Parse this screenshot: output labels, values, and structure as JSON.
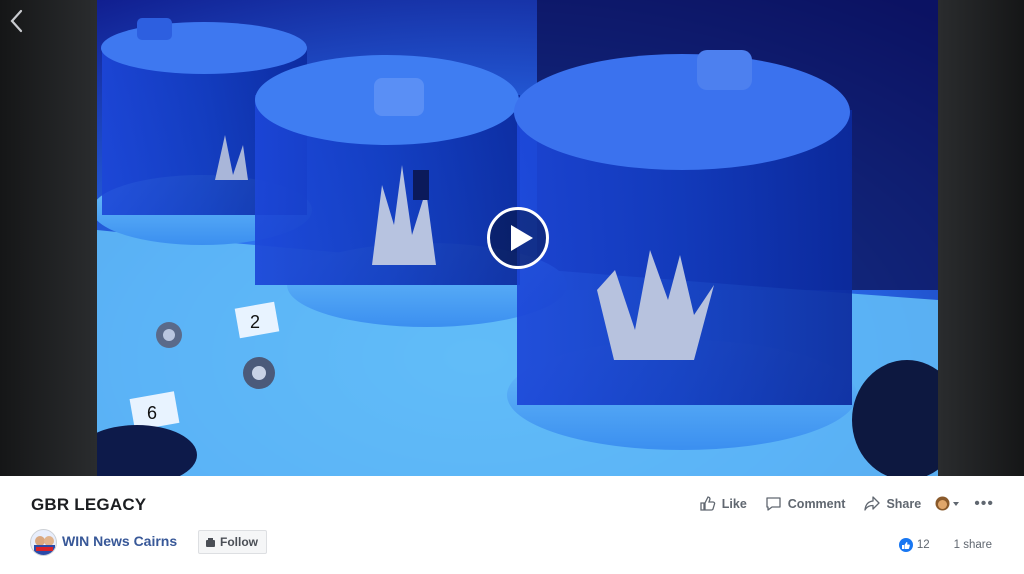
{
  "video": {
    "title": "GBR LEGACY",
    "tank_labels": [
      "2",
      "6"
    ],
    "colors": {
      "accent": "#385898",
      "video_blue": "#1a4fd8"
    }
  },
  "page": {
    "name": "WIN News Cairns",
    "follow_label": "Follow"
  },
  "actions": {
    "like_label": "Like",
    "comment_label": "Comment",
    "share_label": "Share"
  },
  "stats": {
    "likes": "12",
    "shares": "1 share"
  },
  "icons": [
    "back-icon",
    "play-icon",
    "thumbs-up-icon",
    "comment-icon",
    "share-icon",
    "follow-icon",
    "more-icon",
    "like-badge-icon"
  ]
}
